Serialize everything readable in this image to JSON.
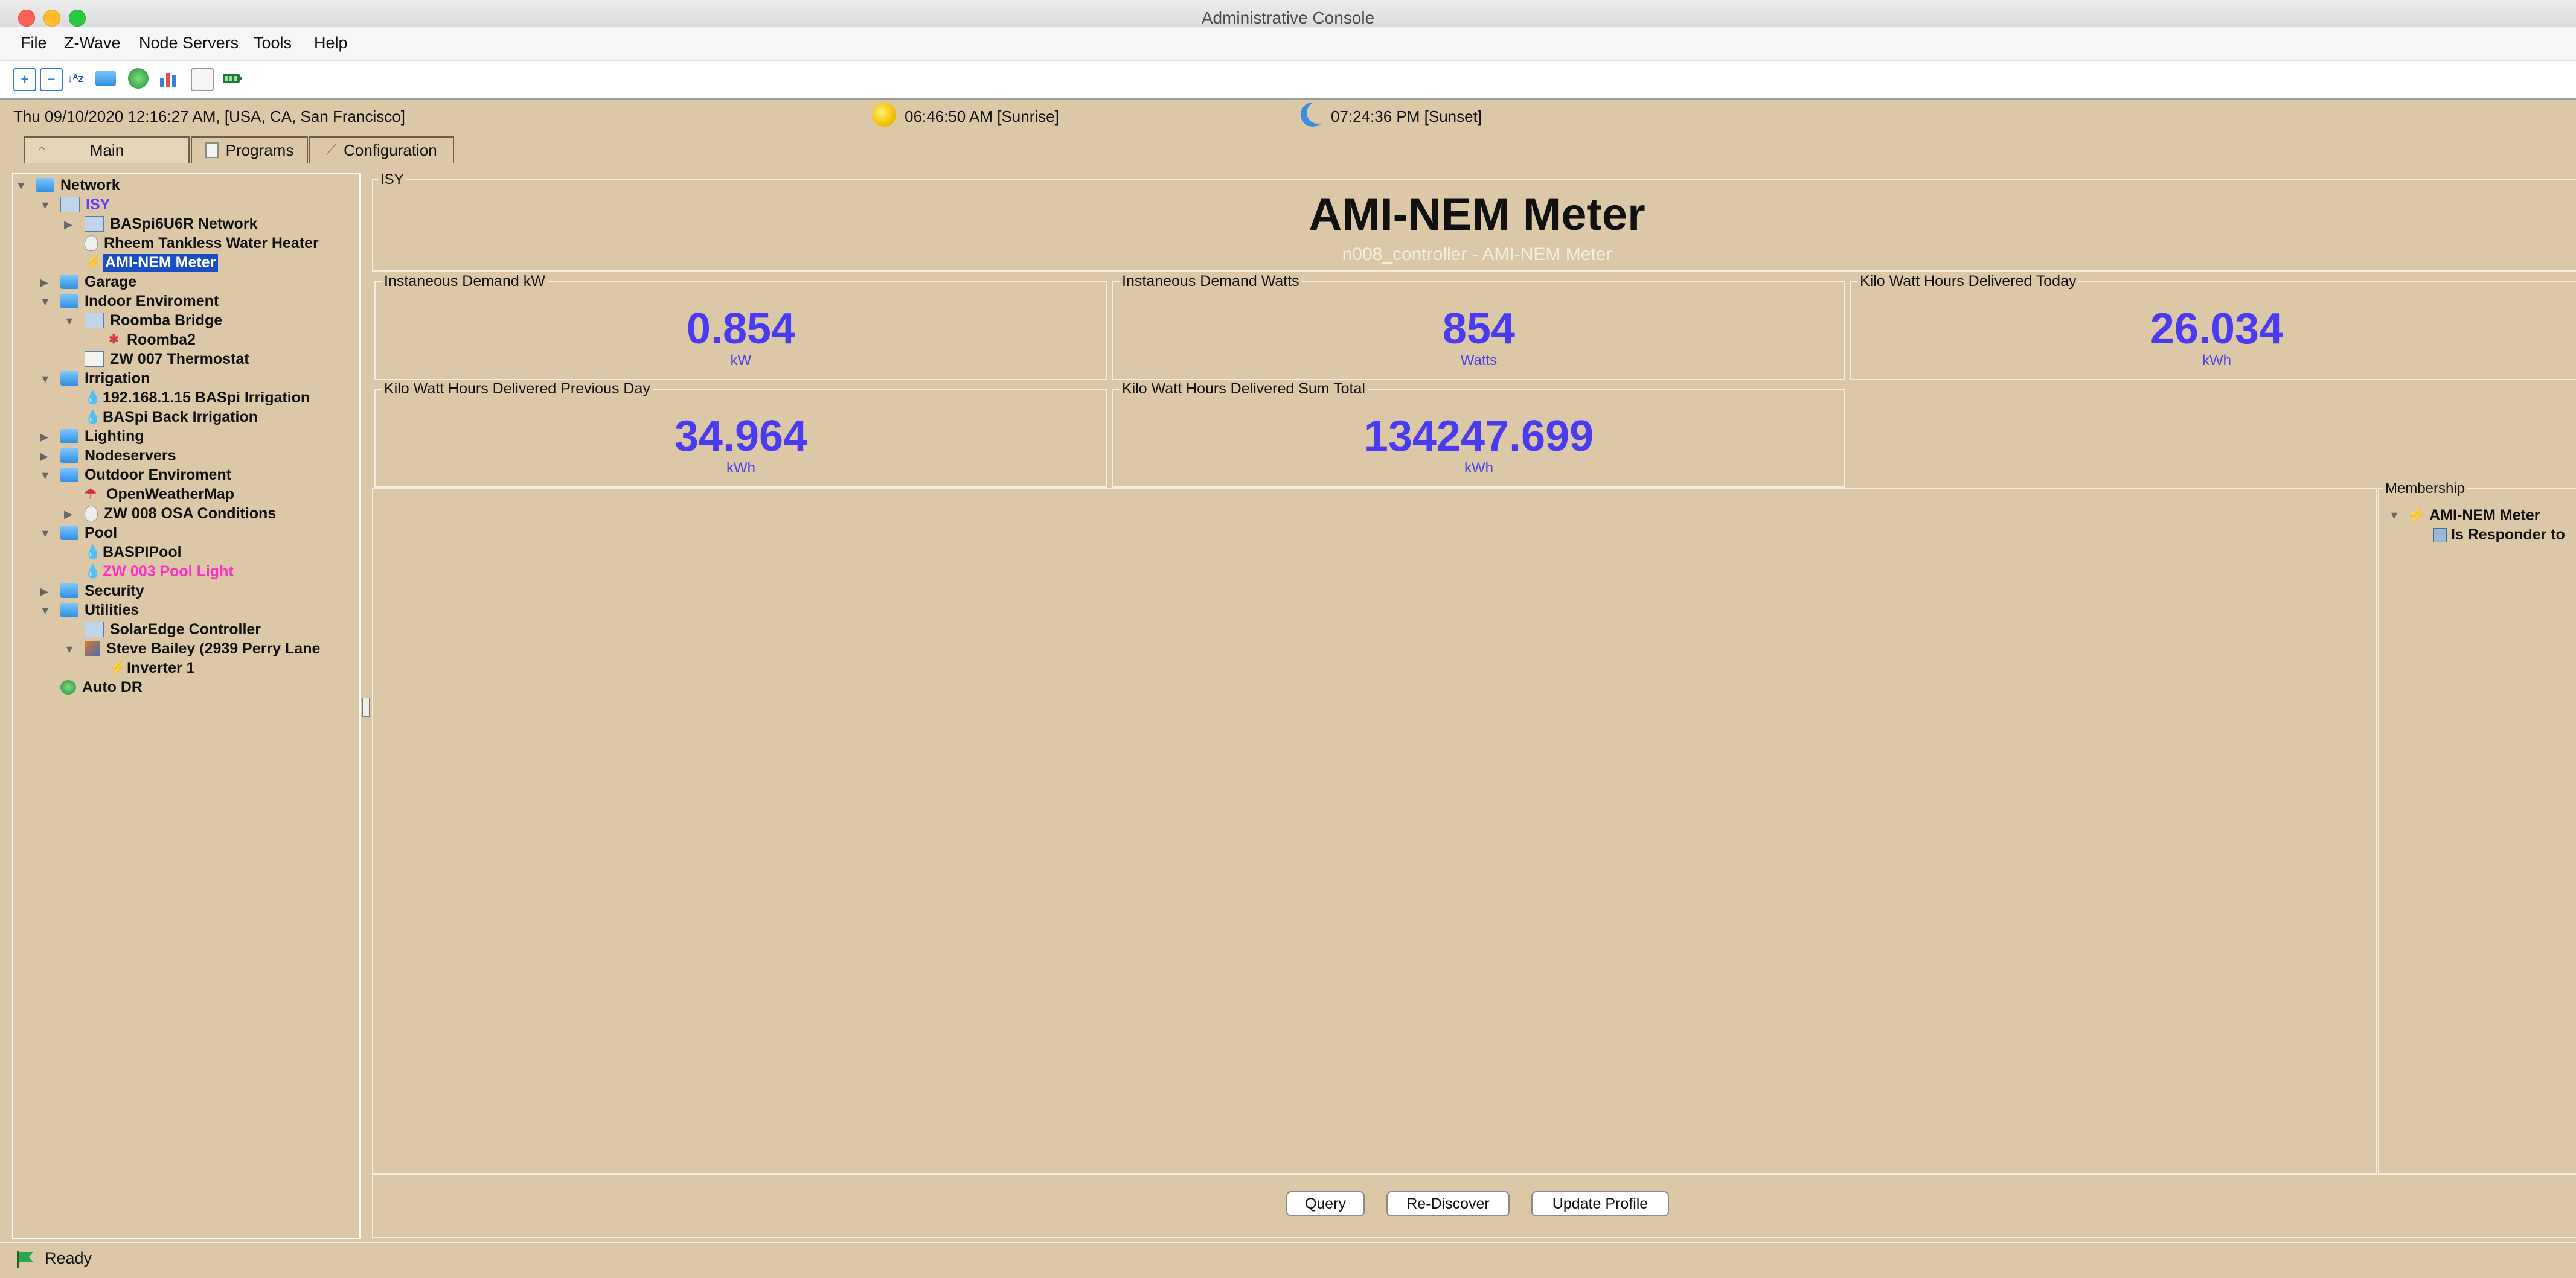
{
  "window": {
    "title": "Administrative Console"
  },
  "menu": [
    "File",
    "Z-Wave",
    "Node Servers",
    "Tools",
    "Help"
  ],
  "toolbar_icons": [
    "expand-all-icon",
    "collapse-all-icon",
    "sort-az-icon",
    "folder-icon",
    "network-icon",
    "chart-icon",
    "blank-page-icon",
    "battery-icon"
  ],
  "status_strip": {
    "datetime": "Thu 09/10/2020 12:16:27 AM,  [USA, CA, San Francisco]",
    "sunrise": "06:46:50 AM [Sunrise]",
    "sunset": "07:24:36 PM [Sunset]"
  },
  "tabs": [
    {
      "label": "Main",
      "icon": "home-icon"
    },
    {
      "label": "Programs",
      "icon": "document-icon"
    },
    {
      "label": "Configuration",
      "icon": "wrench-icon"
    }
  ],
  "tree": {
    "items": [
      {
        "label": "Network",
        "level": 0,
        "arrow": "▼",
        "icon": "folder",
        "style": ""
      },
      {
        "label": "ISY",
        "level": 1,
        "arrow": "▼",
        "icon": "computer",
        "style": "purple"
      },
      {
        "label": "BASpi6U6R Network",
        "level": 2,
        "arrow": "▶",
        "icon": "grid",
        "style": ""
      },
      {
        "label": "Rheem Tankless Water Heater",
        "level": 2,
        "arrow": "",
        "icon": "bulb",
        "style": ""
      },
      {
        "label": "AMI-NEM Meter",
        "level": 2,
        "arrow": "",
        "icon": "bolt",
        "style": "selected"
      },
      {
        "label": "Garage",
        "level": 1,
        "arrow": "▶",
        "icon": "folder",
        "style": ""
      },
      {
        "label": "Indoor Enviroment",
        "level": 1,
        "arrow": "▼",
        "icon": "folder",
        "style": ""
      },
      {
        "label": "Roomba Bridge",
        "level": 2,
        "arrow": "▼",
        "icon": "grid",
        "style": ""
      },
      {
        "label": "Roomba2",
        "level": 3,
        "arrow": "",
        "icon": "robot",
        "style": ""
      },
      {
        "label": "ZW 007 Thermostat",
        "level": 2,
        "arrow": "",
        "icon": "thermostat",
        "style": ""
      },
      {
        "label": "Irrigation",
        "level": 1,
        "arrow": "▼",
        "icon": "folder",
        "style": ""
      },
      {
        "label": "192.168.1.15 BASpi Irrigation",
        "level": 2,
        "arrow": "",
        "icon": "drop",
        "style": ""
      },
      {
        "label": "BASpi Back Irrigation",
        "level": 2,
        "arrow": "",
        "icon": "drop",
        "style": ""
      },
      {
        "label": "Lighting",
        "level": 1,
        "arrow": "▶",
        "icon": "folder",
        "style": ""
      },
      {
        "label": "Nodeservers",
        "level": 1,
        "arrow": "▶",
        "icon": "folder",
        "style": ""
      },
      {
        "label": "Outdoor Enviroment",
        "level": 1,
        "arrow": "▼",
        "icon": "folder",
        "style": ""
      },
      {
        "label": "OpenWeatherMap",
        "level": 2,
        "arrow": "",
        "icon": "umbrella",
        "style": ""
      },
      {
        "label": "ZW 008 OSA Conditions",
        "level": 2,
        "arrow": "▶",
        "icon": "bulb",
        "style": ""
      },
      {
        "label": "Pool",
        "level": 1,
        "arrow": "▼",
        "icon": "folder",
        "style": ""
      },
      {
        "label": "BASPIPool",
        "level": 2,
        "arrow": "",
        "icon": "drop",
        "style": ""
      },
      {
        "label": "ZW 003 Pool Light",
        "level": 2,
        "arrow": "",
        "icon": "drop",
        "style": "pink"
      },
      {
        "label": "Security",
        "level": 1,
        "arrow": "▶",
        "icon": "folder",
        "style": ""
      },
      {
        "label": "Utilities",
        "level": 1,
        "arrow": "▼",
        "icon": "folder",
        "style": ""
      },
      {
        "label": "SolarEdge Controller",
        "level": 2,
        "arrow": "",
        "icon": "grid",
        "style": ""
      },
      {
        "label": "Steve Bailey (2939 Perry Lane",
        "level": 2,
        "arrow": "▼",
        "icon": "solar",
        "style": ""
      },
      {
        "label": "Inverter 1",
        "level": 3,
        "arrow": "",
        "icon": "bolt",
        "style": ""
      },
      {
        "label": "Auto DR",
        "level": 1,
        "arrow": "",
        "icon": "globe",
        "style": ""
      }
    ]
  },
  "content": {
    "frame_label": "ISY",
    "title": "AMI-NEM Meter",
    "subtitle": "n008_controller - AMI-NEM Meter",
    "cards": [
      {
        "label": "Instaneous Demand kW",
        "value": "0.854",
        "unit": "kW"
      },
      {
        "label": "Instaneous Demand Watts",
        "value": "854",
        "unit": "Watts"
      },
      {
        "label": "Kilo Watt Hours Delivered Today",
        "value": "26.034",
        "unit": "kWh"
      },
      {
        "label": "Kilo Watt Hours Delivered Previous Day",
        "value": "34.964",
        "unit": "kWh"
      },
      {
        "label": "Kilo Watt Hours Delivered Sum Total",
        "value": "134247.699",
        "unit": "kWh"
      }
    ],
    "membership": {
      "label": "Membership",
      "items": [
        "AMI-NEM Meter",
        "Is Responder to"
      ]
    },
    "buttons": {
      "query": "Query",
      "rediscover": "Re-Discover",
      "update_profile": "Update Profile"
    }
  },
  "footer": {
    "status": "Ready"
  },
  "colors": {
    "background": "#dcc8a6",
    "value_blue": "#4a3af0",
    "selection": "#1a4fc4",
    "pink": "#ff2ec8"
  }
}
